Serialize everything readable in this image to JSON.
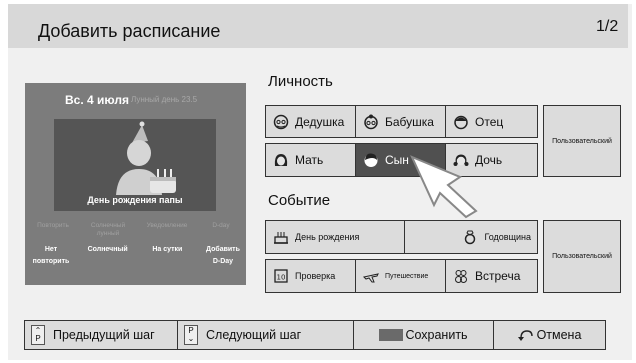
{
  "header": {
    "title": "Добавить расписание",
    "page": "1/2"
  },
  "preview": {
    "date": "Вс. 4 июля",
    "lunar": "Лунный день 23.5",
    "caption": "День рождения папы",
    "options": [
      {
        "label": "Повторить",
        "value": "Нет повторить"
      },
      {
        "label": "Солнечный лунный",
        "value": "Солнечный"
      },
      {
        "label": "Уведомление",
        "value": "На сутки"
      },
      {
        "label": "D-day",
        "value": "Добавить D-Day"
      }
    ]
  },
  "personality": {
    "title": "Личность",
    "items": [
      "Дедушка",
      "Бабушка",
      "Отец",
      "Мать",
      "Сын",
      "Дочь"
    ],
    "selected": "Сын",
    "custom": "Пользовательский"
  },
  "event": {
    "title": "Событие",
    "items": [
      "День рождения",
      "Годовщина",
      "Проверка",
      "Путешествие",
      "Встреча"
    ],
    "custom": "Пользовательский"
  },
  "bottom": {
    "prev_key": "P",
    "prev_label": "Предыдущий шаг",
    "next_key": "P",
    "next_label": "Следующий шаг",
    "save_label": "Сохранить",
    "cancel_label": "Отмена"
  },
  "colors": {
    "selected": "#505050",
    "panel": "#dcdcdc",
    "preview": "#7c7c7c"
  }
}
